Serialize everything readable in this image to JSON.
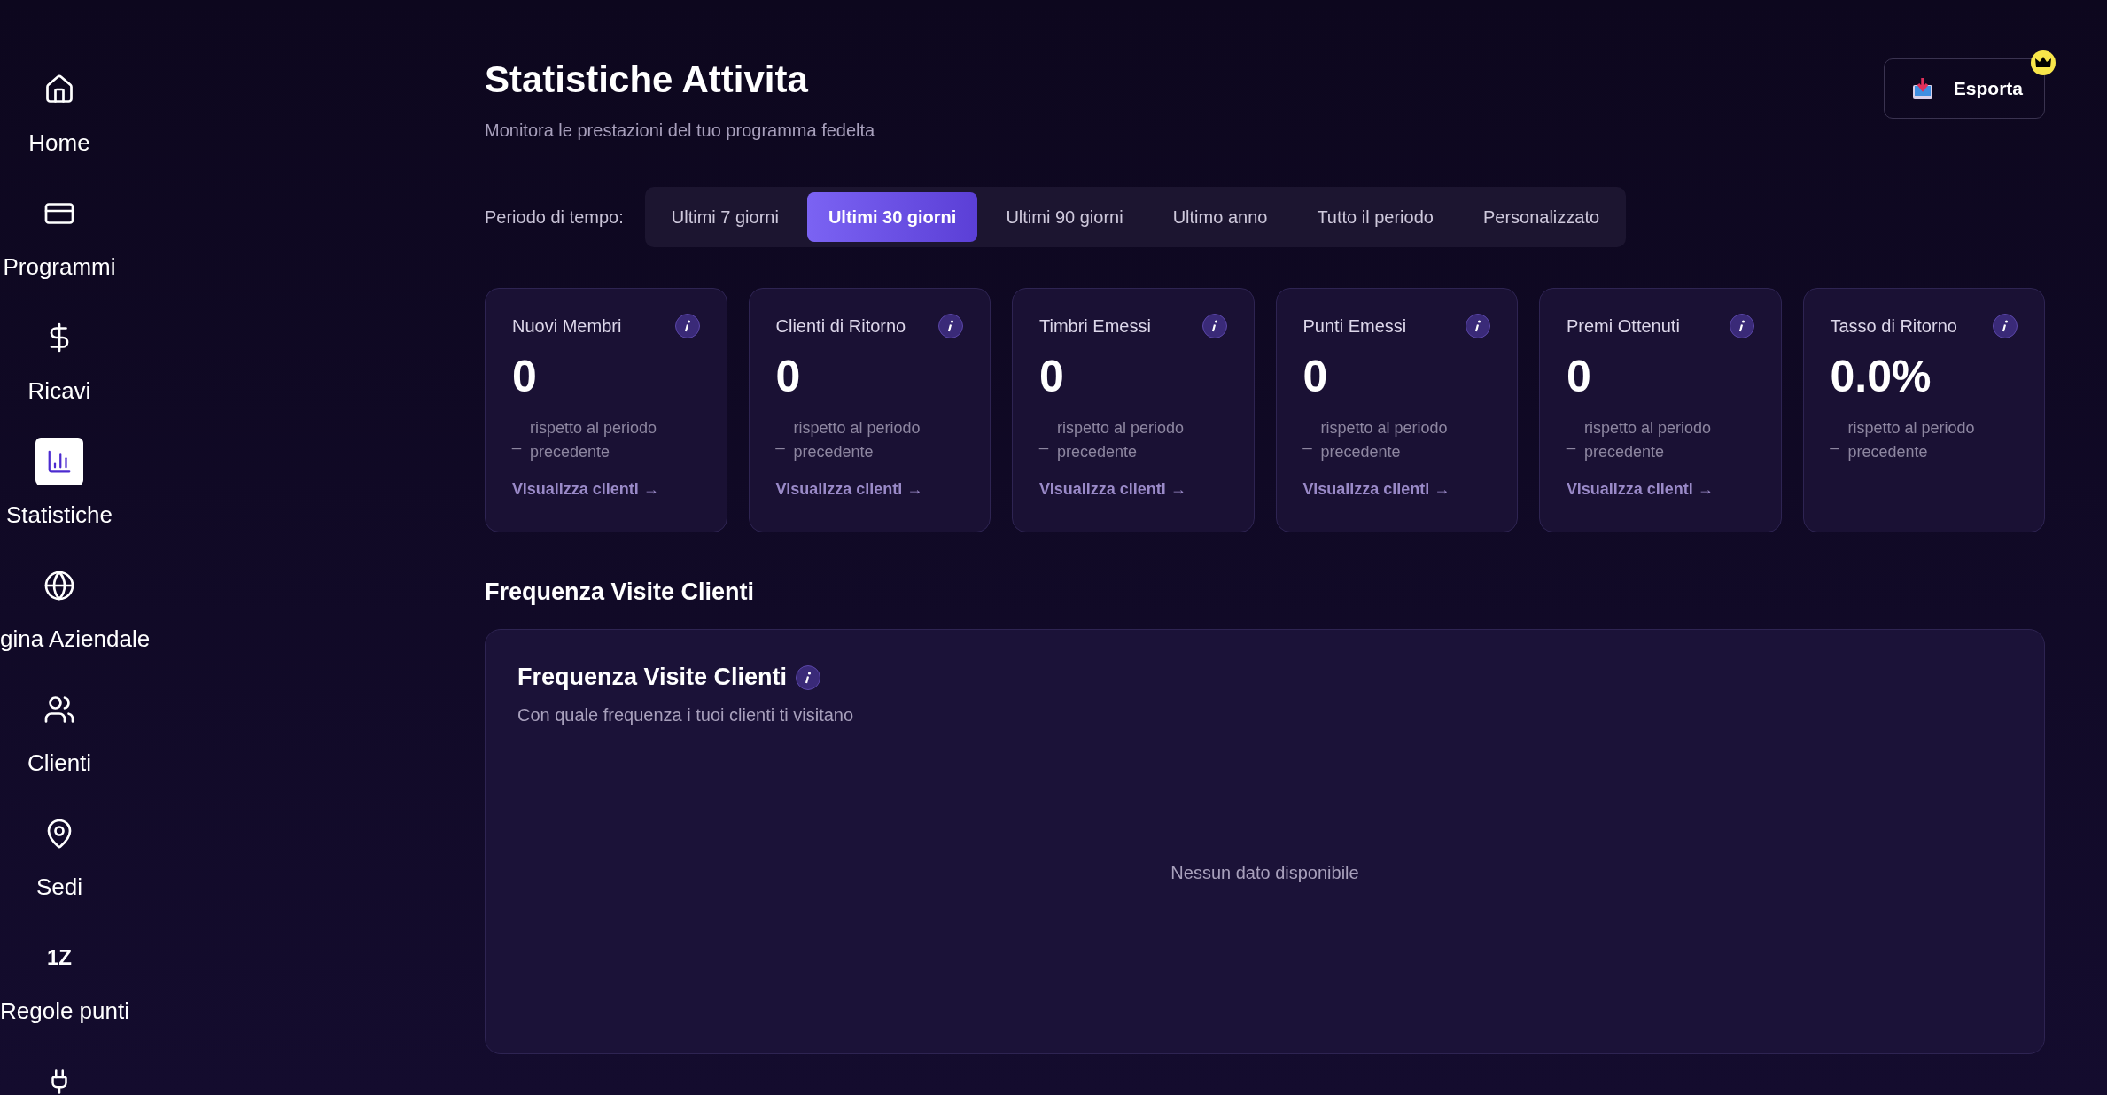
{
  "sidebar": {
    "items": [
      {
        "kind": "home",
        "label": "Home",
        "selected": false
      },
      {
        "kind": "card",
        "label": "Programmi",
        "selected": false
      },
      {
        "kind": "dollar",
        "label": "Ricavi",
        "selected": false
      },
      {
        "kind": "chart",
        "label": "Statistiche",
        "selected": true
      },
      {
        "kind": "globe",
        "label": "gina Aziendale",
        "selected": false
      },
      {
        "kind": "users",
        "label": "Clienti",
        "selected": false
      },
      {
        "kind": "pin",
        "label": "Sedi",
        "selected": false
      },
      {
        "kind": "glyph",
        "glyph": "1Z",
        "label": "Regole punti",
        "selected": false
      }
    ]
  },
  "header": {
    "title": "Statistiche Attivita",
    "subtitle": "Monitora le prestazioni del tuo programma fedelta",
    "export_button": "Esporta",
    "premium": true
  },
  "period": {
    "label": "Periodo di tempo:",
    "tabs": [
      {
        "label": "Ultimi 7 giorni",
        "selected": false
      },
      {
        "label": "Ultimi 30 giorni",
        "selected": true
      },
      {
        "label": "Ultimi 90 giorni",
        "selected": false
      },
      {
        "label": "Ultimo anno",
        "selected": false
      },
      {
        "label": "Tutto il periodo",
        "selected": false
      },
      {
        "label": "Personalizzato",
        "selected": false
      }
    ]
  },
  "cards": [
    {
      "title": "Nuovi Membri",
      "value": "0",
      "trend": "_",
      "comparison": "rispetto al periodo precedente",
      "link": "Visualizza clienti →"
    },
    {
      "title": "Clienti di Ritorno",
      "value": "0",
      "trend": "_",
      "comparison": "rispetto al periodo precedente",
      "link": "Visualizza clienti →"
    },
    {
      "title": "Timbri Emessi",
      "value": "0",
      "trend": "_",
      "comparison": "rispetto al periodo precedente",
      "link": "Visualizza clienti →"
    },
    {
      "title": "Punti Emessi",
      "value": "0",
      "trend": "_",
      "comparison": "rispetto al periodo precedente",
      "link": "Visualizza clienti →"
    },
    {
      "title": "Premi Ottenuti",
      "value": "0",
      "trend": "_",
      "comparison": "rispetto al periodo precedente",
      "link": "Visualizza clienti →"
    },
    {
      "title": "Tasso di Ritorno",
      "value": "0.0%",
      "trend": "_",
      "comparison": "rispetto al periodo precedente"
    }
  ],
  "section": {
    "heading": "Frequenza Visite Clienti",
    "panel": {
      "title": "Frequenza Visite Clienti",
      "subtitle": "Con quale frequenza i tuoi clienti ti visitano",
      "empty": "Nessun dato disponibile"
    }
  }
}
